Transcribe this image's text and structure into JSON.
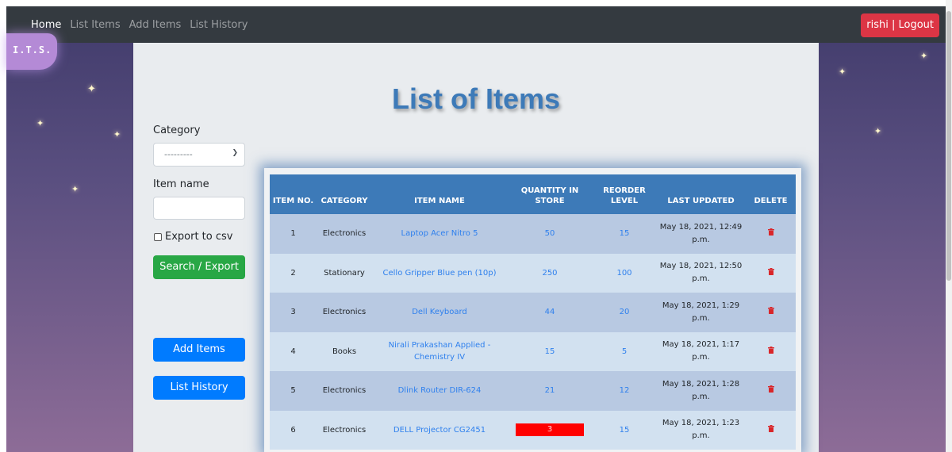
{
  "nav": {
    "links": [
      "Home",
      "List Items",
      "Add Items",
      "List History"
    ],
    "user_button": "rishi | Logout"
  },
  "logo": "I.T.S.",
  "page_title": "List of Items",
  "filter": {
    "category_label": "Category",
    "category_selected": "---------",
    "item_name_label": "Item name",
    "export_label": "Export to csv",
    "search_button": "Search / Export",
    "add_items_button": "Add Items",
    "list_history_button": "List History"
  },
  "table": {
    "headers": [
      "ITEM NO.",
      "CATEGORY",
      "ITEM NAME",
      "QUANTITY IN STORE",
      "REORDER LEVEL",
      "LAST UPDATED",
      "DELETE"
    ],
    "rows": [
      {
        "no": "1",
        "category": "Electronics",
        "name": "Laptop Acer Nitro 5",
        "qty": "50",
        "reorder": "15",
        "updated": "May 18, 2021, 12:49 p.m."
      },
      {
        "no": "2",
        "category": "Stationary",
        "name": "Cello Gripper Blue pen (10p)",
        "qty": "250",
        "reorder": "100",
        "updated": "May 18, 2021, 12:50 p.m."
      },
      {
        "no": "3",
        "category": "Electronics",
        "name": "Dell Keyboard",
        "qty": "44",
        "reorder": "20",
        "updated": "May 18, 2021, 1:29 p.m."
      },
      {
        "no": "4",
        "category": "Books",
        "name": "Nirali Prakashan Applied - Chemistry IV",
        "qty": "15",
        "reorder": "5",
        "updated": "May 18, 2021, 1:17 p.m."
      },
      {
        "no": "5",
        "category": "Electronics",
        "name": "Dlink Router DIR-624",
        "qty": "21",
        "reorder": "12",
        "updated": "May 18, 2021, 1:28 p.m."
      },
      {
        "no": "6",
        "category": "Electronics",
        "name": "DELL Projector CG2451",
        "qty": "3",
        "reorder": "15",
        "updated": "May 18, 2021, 1:23 p.m."
      }
    ]
  },
  "colors": {
    "navbar": "#343a40",
    "logout": "#dc3545",
    "title": "#3d7ab8",
    "header_row": "#3d7ab8",
    "link": "#2f80ed",
    "low_stock": "#ff0000",
    "search_button": "#28a745",
    "nav_buttons": "#007bff"
  }
}
